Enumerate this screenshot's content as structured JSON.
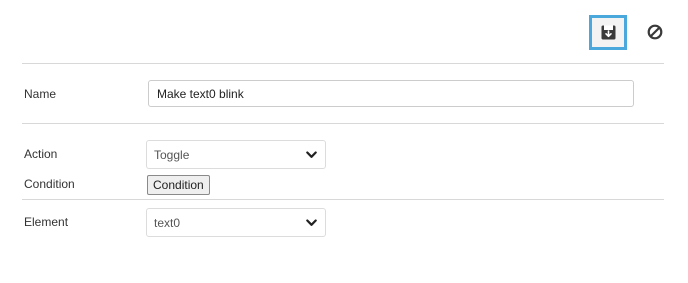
{
  "toolbar": {
    "save_icon": "save-floppy-icon",
    "cancel_icon": "prohibited-icon",
    "accent_color": "#4aa8dc"
  },
  "form": {
    "name_label": "Name",
    "name_value": "Make text0 blink",
    "action_label": "Action",
    "action_value": "Toggle",
    "condition_label": "Condition",
    "condition_button": "Condition",
    "element_label": "Element",
    "element_value": "text0"
  }
}
